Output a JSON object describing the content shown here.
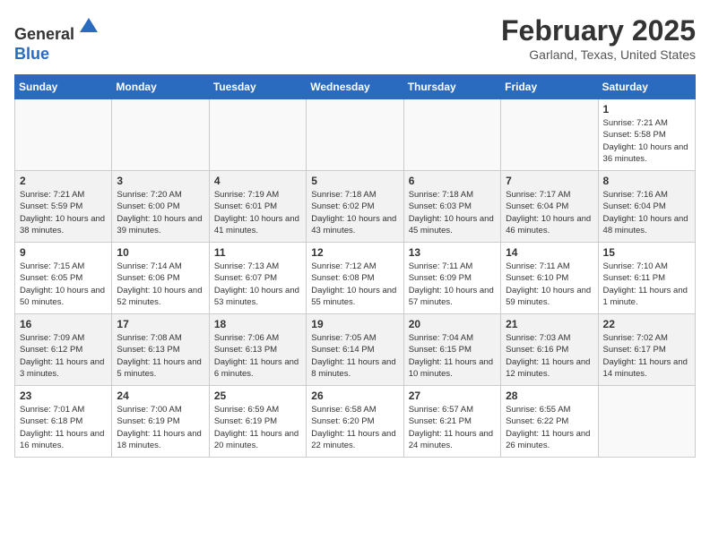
{
  "header": {
    "logo_line1": "General",
    "logo_line2": "Blue",
    "month_title": "February 2025",
    "location": "Garland, Texas, United States"
  },
  "days_of_week": [
    "Sunday",
    "Monday",
    "Tuesday",
    "Wednesday",
    "Thursday",
    "Friday",
    "Saturday"
  ],
  "weeks": [
    [
      {
        "day": "",
        "info": ""
      },
      {
        "day": "",
        "info": ""
      },
      {
        "day": "",
        "info": ""
      },
      {
        "day": "",
        "info": ""
      },
      {
        "day": "",
        "info": ""
      },
      {
        "day": "",
        "info": ""
      },
      {
        "day": "1",
        "info": "Sunrise: 7:21 AM\nSunset: 5:58 PM\nDaylight: 10 hours and 36 minutes."
      }
    ],
    [
      {
        "day": "2",
        "info": "Sunrise: 7:21 AM\nSunset: 5:59 PM\nDaylight: 10 hours and 38 minutes."
      },
      {
        "day": "3",
        "info": "Sunrise: 7:20 AM\nSunset: 6:00 PM\nDaylight: 10 hours and 39 minutes."
      },
      {
        "day": "4",
        "info": "Sunrise: 7:19 AM\nSunset: 6:01 PM\nDaylight: 10 hours and 41 minutes."
      },
      {
        "day": "5",
        "info": "Sunrise: 7:18 AM\nSunset: 6:02 PM\nDaylight: 10 hours and 43 minutes."
      },
      {
        "day": "6",
        "info": "Sunrise: 7:18 AM\nSunset: 6:03 PM\nDaylight: 10 hours and 45 minutes."
      },
      {
        "day": "7",
        "info": "Sunrise: 7:17 AM\nSunset: 6:04 PM\nDaylight: 10 hours and 46 minutes."
      },
      {
        "day": "8",
        "info": "Sunrise: 7:16 AM\nSunset: 6:04 PM\nDaylight: 10 hours and 48 minutes."
      }
    ],
    [
      {
        "day": "9",
        "info": "Sunrise: 7:15 AM\nSunset: 6:05 PM\nDaylight: 10 hours and 50 minutes."
      },
      {
        "day": "10",
        "info": "Sunrise: 7:14 AM\nSunset: 6:06 PM\nDaylight: 10 hours and 52 minutes."
      },
      {
        "day": "11",
        "info": "Sunrise: 7:13 AM\nSunset: 6:07 PM\nDaylight: 10 hours and 53 minutes."
      },
      {
        "day": "12",
        "info": "Sunrise: 7:12 AM\nSunset: 6:08 PM\nDaylight: 10 hours and 55 minutes."
      },
      {
        "day": "13",
        "info": "Sunrise: 7:11 AM\nSunset: 6:09 PM\nDaylight: 10 hours and 57 minutes."
      },
      {
        "day": "14",
        "info": "Sunrise: 7:11 AM\nSunset: 6:10 PM\nDaylight: 10 hours and 59 minutes."
      },
      {
        "day": "15",
        "info": "Sunrise: 7:10 AM\nSunset: 6:11 PM\nDaylight: 11 hours and 1 minute."
      }
    ],
    [
      {
        "day": "16",
        "info": "Sunrise: 7:09 AM\nSunset: 6:12 PM\nDaylight: 11 hours and 3 minutes."
      },
      {
        "day": "17",
        "info": "Sunrise: 7:08 AM\nSunset: 6:13 PM\nDaylight: 11 hours and 5 minutes."
      },
      {
        "day": "18",
        "info": "Sunrise: 7:06 AM\nSunset: 6:13 PM\nDaylight: 11 hours and 6 minutes."
      },
      {
        "day": "19",
        "info": "Sunrise: 7:05 AM\nSunset: 6:14 PM\nDaylight: 11 hours and 8 minutes."
      },
      {
        "day": "20",
        "info": "Sunrise: 7:04 AM\nSunset: 6:15 PM\nDaylight: 11 hours and 10 minutes."
      },
      {
        "day": "21",
        "info": "Sunrise: 7:03 AM\nSunset: 6:16 PM\nDaylight: 11 hours and 12 minutes."
      },
      {
        "day": "22",
        "info": "Sunrise: 7:02 AM\nSunset: 6:17 PM\nDaylight: 11 hours and 14 minutes."
      }
    ],
    [
      {
        "day": "23",
        "info": "Sunrise: 7:01 AM\nSunset: 6:18 PM\nDaylight: 11 hours and 16 minutes."
      },
      {
        "day": "24",
        "info": "Sunrise: 7:00 AM\nSunset: 6:19 PM\nDaylight: 11 hours and 18 minutes."
      },
      {
        "day": "25",
        "info": "Sunrise: 6:59 AM\nSunset: 6:19 PM\nDaylight: 11 hours and 20 minutes."
      },
      {
        "day": "26",
        "info": "Sunrise: 6:58 AM\nSunset: 6:20 PM\nDaylight: 11 hours and 22 minutes."
      },
      {
        "day": "27",
        "info": "Sunrise: 6:57 AM\nSunset: 6:21 PM\nDaylight: 11 hours and 24 minutes."
      },
      {
        "day": "28",
        "info": "Sunrise: 6:55 AM\nSunset: 6:22 PM\nDaylight: 11 hours and 26 minutes."
      },
      {
        "day": "",
        "info": ""
      }
    ]
  ]
}
